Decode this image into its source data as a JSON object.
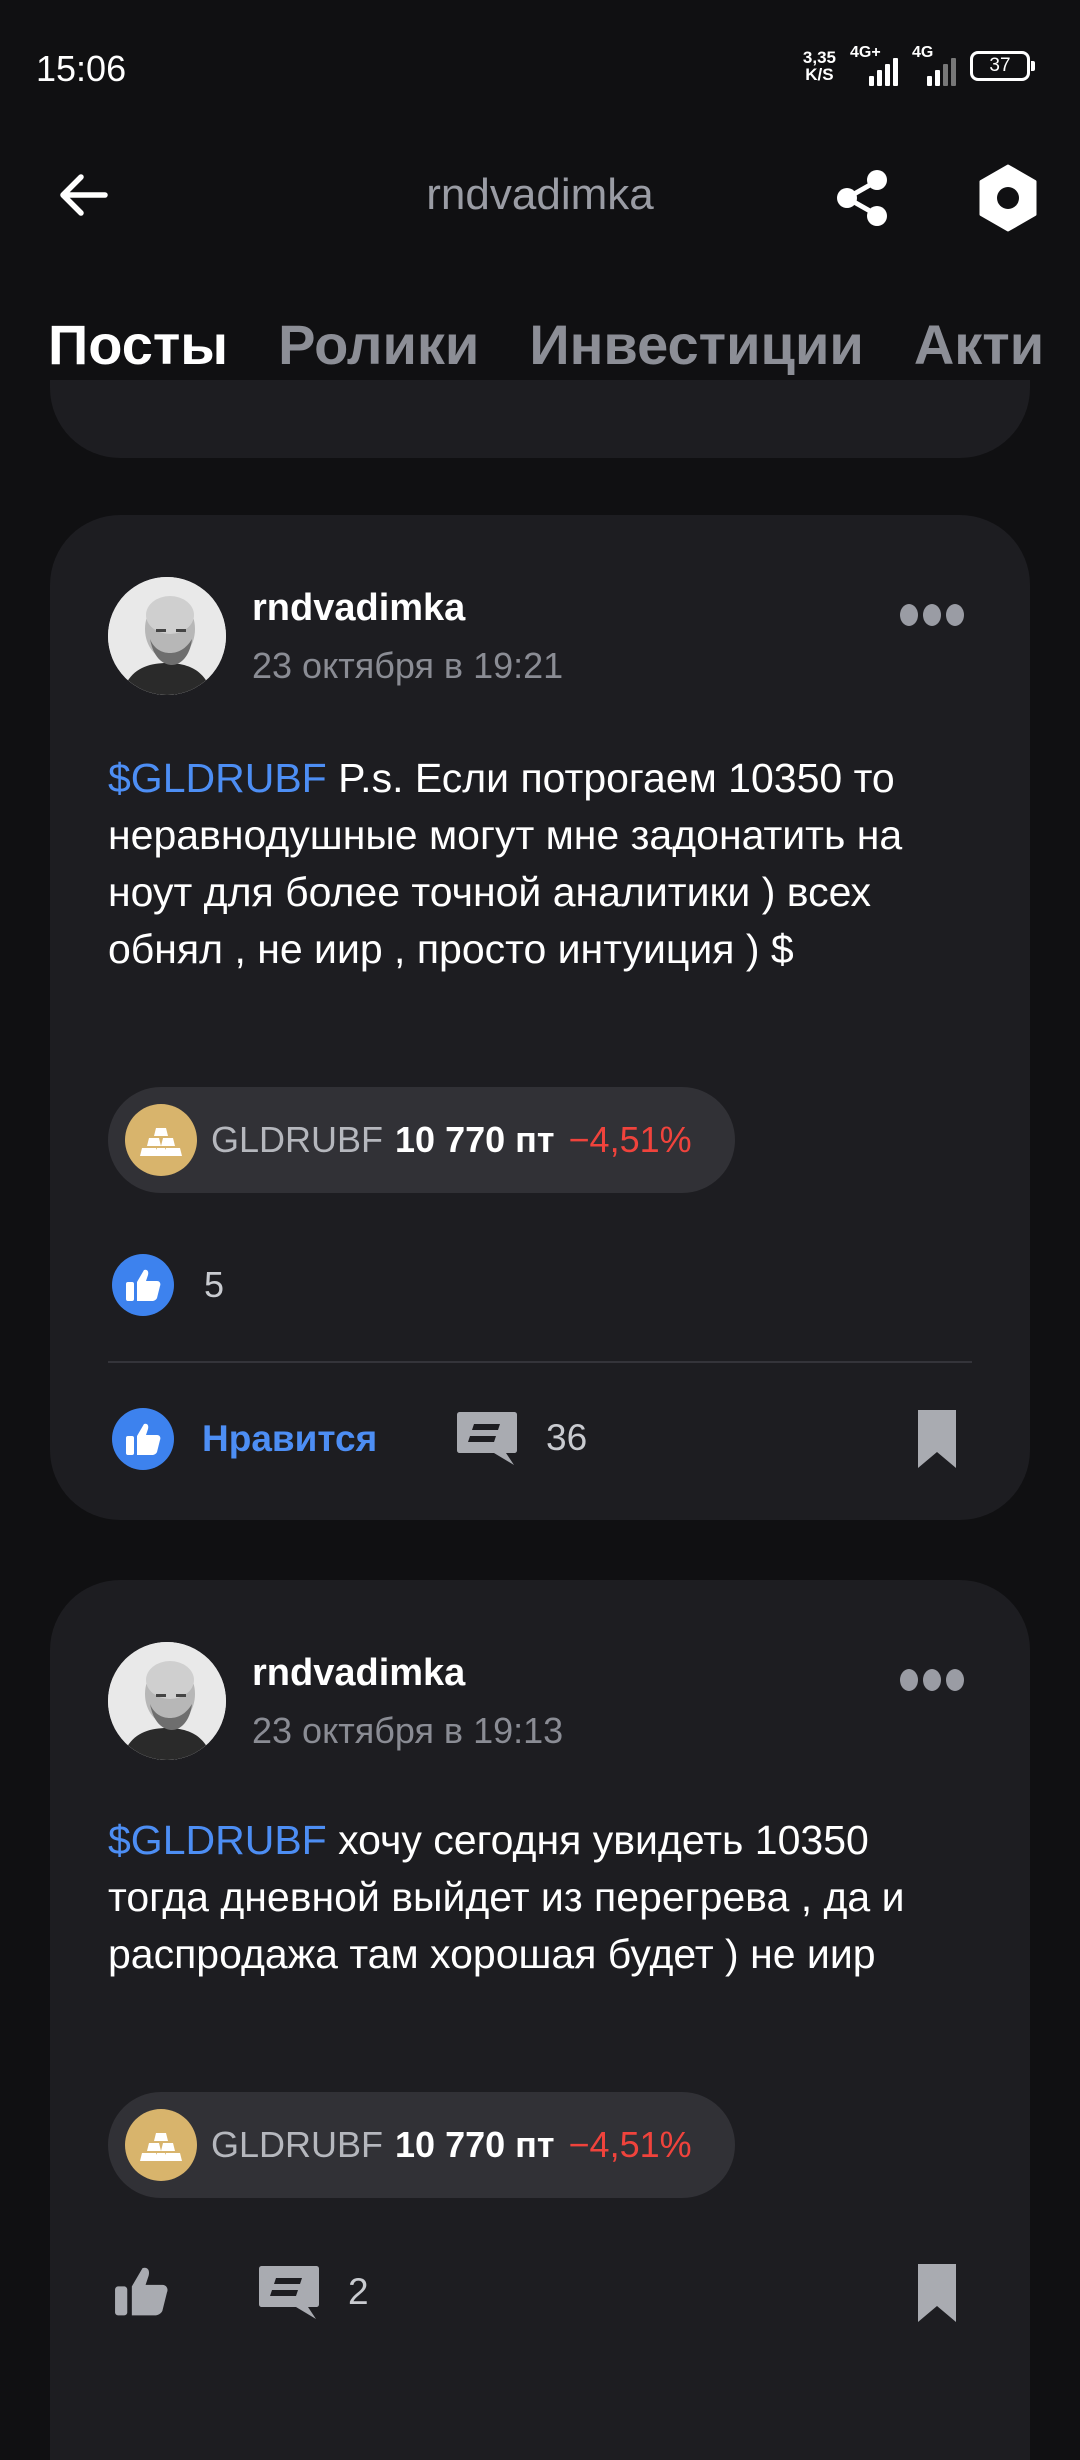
{
  "status_bar": {
    "time": "15:06",
    "net_speed_value": "3,35",
    "net_speed_unit": "K/S",
    "signal1_label": "4G+",
    "signal2_label": "4G",
    "battery": "37"
  },
  "header": {
    "title": "rndvadimka",
    "icons": [
      "back-arrow-icon",
      "share-icon",
      "settings-icon"
    ]
  },
  "tabs": [
    {
      "label": "Посты",
      "active": true
    },
    {
      "label": "Ролики",
      "active": false
    },
    {
      "label": "Инвестиции",
      "active": false
    },
    {
      "label": "Акти",
      "active": false
    }
  ],
  "posts": [
    {
      "author": "rndvadimka",
      "date": "23 октября в 19:21",
      "ticker_tag": "$GLDRUBF",
      "text": " P.s. Если потрогаем 10350 то неравнодушные могут мне задонатить на ноут для более точной аналитики ) всех обнял , не иир , просто интуиция ) $",
      "instrument": {
        "ticker": "GLDRUBF",
        "price": "10 770 пт",
        "change": "−4,51%"
      },
      "likes": "5",
      "like_label": "Нравится",
      "comments": "36"
    },
    {
      "author": "rndvadimka",
      "date": "23 октября в 19:13",
      "ticker_tag": "$GLDRUBF",
      "text": " хочу сегодня увидеть 10350 тогда дневной выйдет из перегрева , да и распродажа там хорошая будет ) не иир",
      "instrument": {
        "ticker": "GLDRUBF",
        "price": "10 770 пт",
        "change": "−4,51%"
      },
      "comments": "2"
    }
  ],
  "colors": {
    "background": "#101012",
    "card": "#1d1d21",
    "accent_blue": "#4d8ef4",
    "negative_red": "#f0433c",
    "chip": "#313136",
    "gold_icon": "#d8b46c"
  }
}
